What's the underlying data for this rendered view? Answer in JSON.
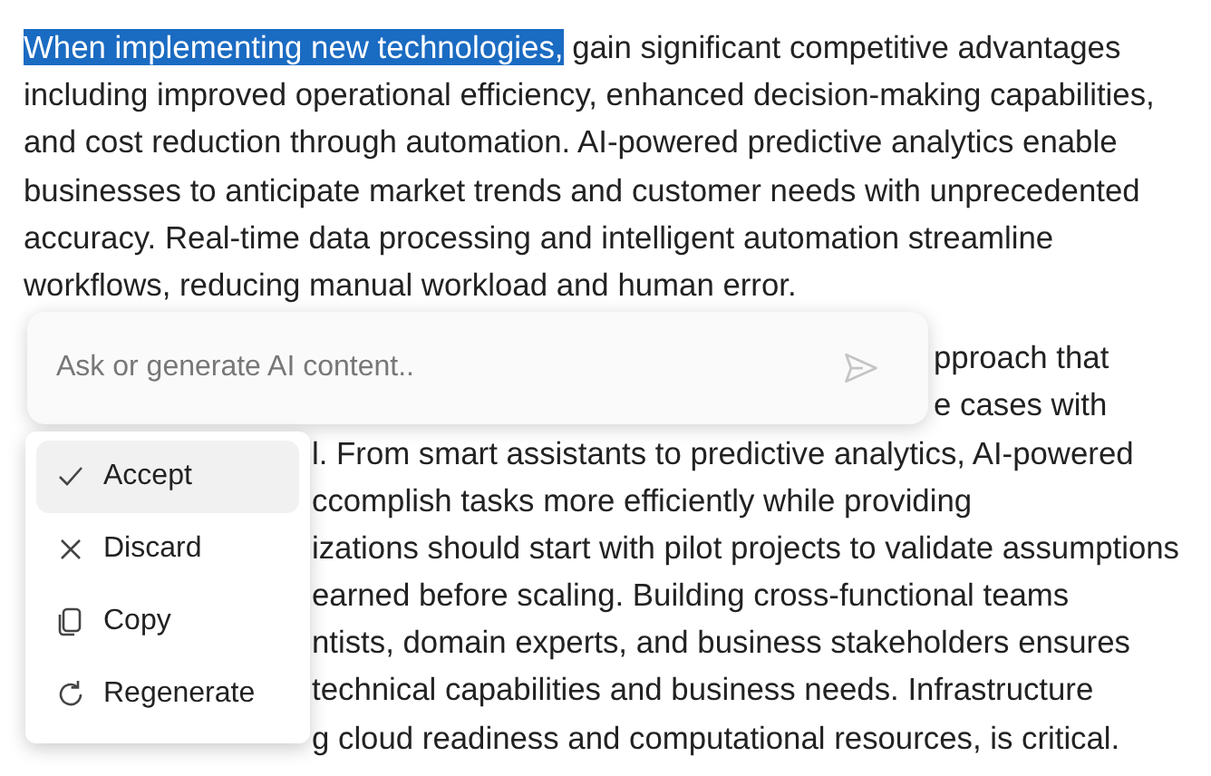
{
  "paragraphs": [
    {
      "lines": [
        {
          "selected_text": "When implementing new technologies,",
          "text": " gain significant competitive advantages"
        },
        {
          "text": "including improved operational efficiency, enhanced decision-making capabilities,"
        },
        {
          "text": "and cost reduction through automation. AI-powered predictive analytics enable"
        },
        {
          "text": "businesses to anticipate market trends and customer needs with unprecedented"
        },
        {
          "text": "accuracy. Real-time data processing and intelligent automation streamline"
        },
        {
          "text": "workflows, reducing manual workload and human error."
        }
      ]
    },
    {
      "lines": [
        {
          "kind": "beside-input",
          "text": "pproach that"
        },
        {
          "kind": "beside-input",
          "text": "e cases with"
        },
        {
          "kind": "beside-menu",
          "text": "l. From smart assistants to predictive analytics, AI-powered"
        },
        {
          "kind": "beside-menu",
          "text": "ccomplish tasks more efficiently while providing"
        },
        {
          "kind": "beside-menu",
          "text": "izations should start with pilot projects to validate assumptions"
        },
        {
          "kind": "beside-menu",
          "text": "earned before scaling. Building cross-functional teams"
        },
        {
          "kind": "beside-menu",
          "text": "ntists, domain experts, and business stakeholders ensures"
        },
        {
          "kind": "beside-menu",
          "text": "technical capabilities and business needs. Infrastructure"
        },
        {
          "kind": "beside-menu",
          "text": "g cloud readiness and computational resources, is critical."
        }
      ]
    }
  ],
  "prompt": {
    "placeholder": "Ask or generate AI content.."
  },
  "menu": [
    {
      "label": "Accept",
      "selected": true
    },
    {
      "label": "Discard",
      "selected": false
    },
    {
      "label": "Copy",
      "selected": false
    },
    {
      "label": "Regenerate",
      "selected": false
    }
  ]
}
